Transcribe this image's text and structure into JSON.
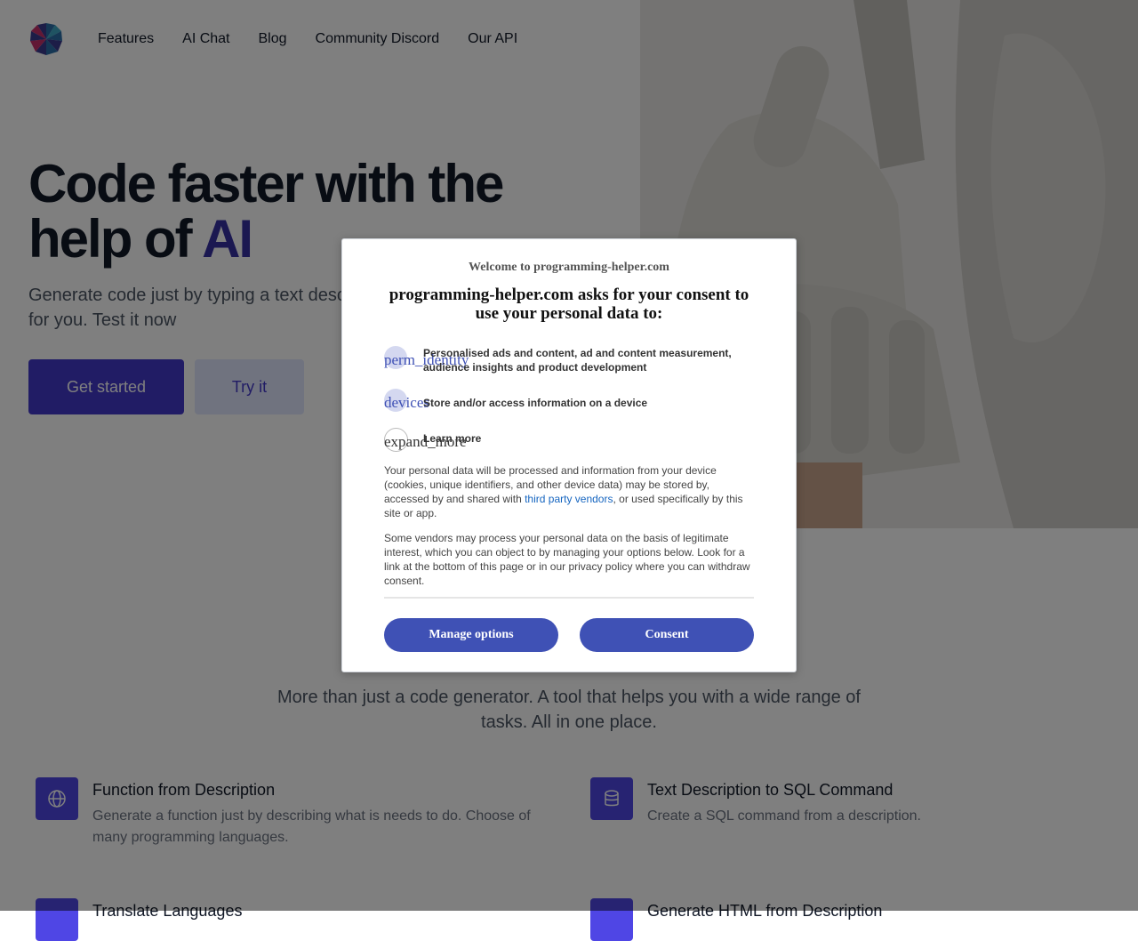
{
  "nav": {
    "links": [
      "Features",
      "AI Chat",
      "Blog",
      "Community Discord",
      "Our API"
    ]
  },
  "hero": {
    "title_line1": "Code faster with the",
    "title_line2_prefix": "help of ",
    "title_accent": "AI",
    "subtitle": "Generate code just by typing a text description. AI will create the code for you. Test it now",
    "primary_button": "Get started",
    "secondary_button": "Try it"
  },
  "tagline": "More than just a code generator. A tool that helps you with a wide range of tasks. All in one place.",
  "features": [
    {
      "title": "Function from Description",
      "desc": "Generate a function just by describing what is needs to do. Choose of many programming languages.",
      "icon": "globe-icon"
    },
    {
      "title": "Text Description to SQL Command",
      "desc": "Create a SQL command from a description.",
      "icon": "database-icon"
    },
    {
      "title": "Translate Languages",
      "desc": "",
      "icon": "translate-icon"
    },
    {
      "title": "Generate HTML from Description",
      "desc": "",
      "icon": "html-icon"
    }
  ],
  "consent": {
    "welcome": "Welcome to programming-helper.com",
    "heading": "programming-helper.com asks for your consent to use your personal data to:",
    "purposes": [
      {
        "ligature": "perm_identity",
        "label": "Personalised ads and content, ad and content measurement, audience insights and product development"
      },
      {
        "ligature": "devices",
        "label": "Store and/or access information on a device"
      },
      {
        "ligature": "expand_more",
        "label": "Learn more"
      }
    ],
    "para1_before": "Your personal data will be processed and information from your device (cookies, unique identifiers, and other device data) may be stored by, accessed by and shared with ",
    "para1_link": "third party vendors",
    "para1_after": ", or used specifically by this site or app.",
    "para2": "Some vendors may process your personal data on the basis of legitimate interest, which you can object to by managing your options below. Look for a link at the bottom of this page or in our privacy policy where you can withdraw consent.",
    "manage_button": "Manage options",
    "consent_button": "Consent"
  },
  "colors": {
    "accent": "#4338ca",
    "dialog_button": "#3f51b5",
    "link": "#1565c0"
  }
}
